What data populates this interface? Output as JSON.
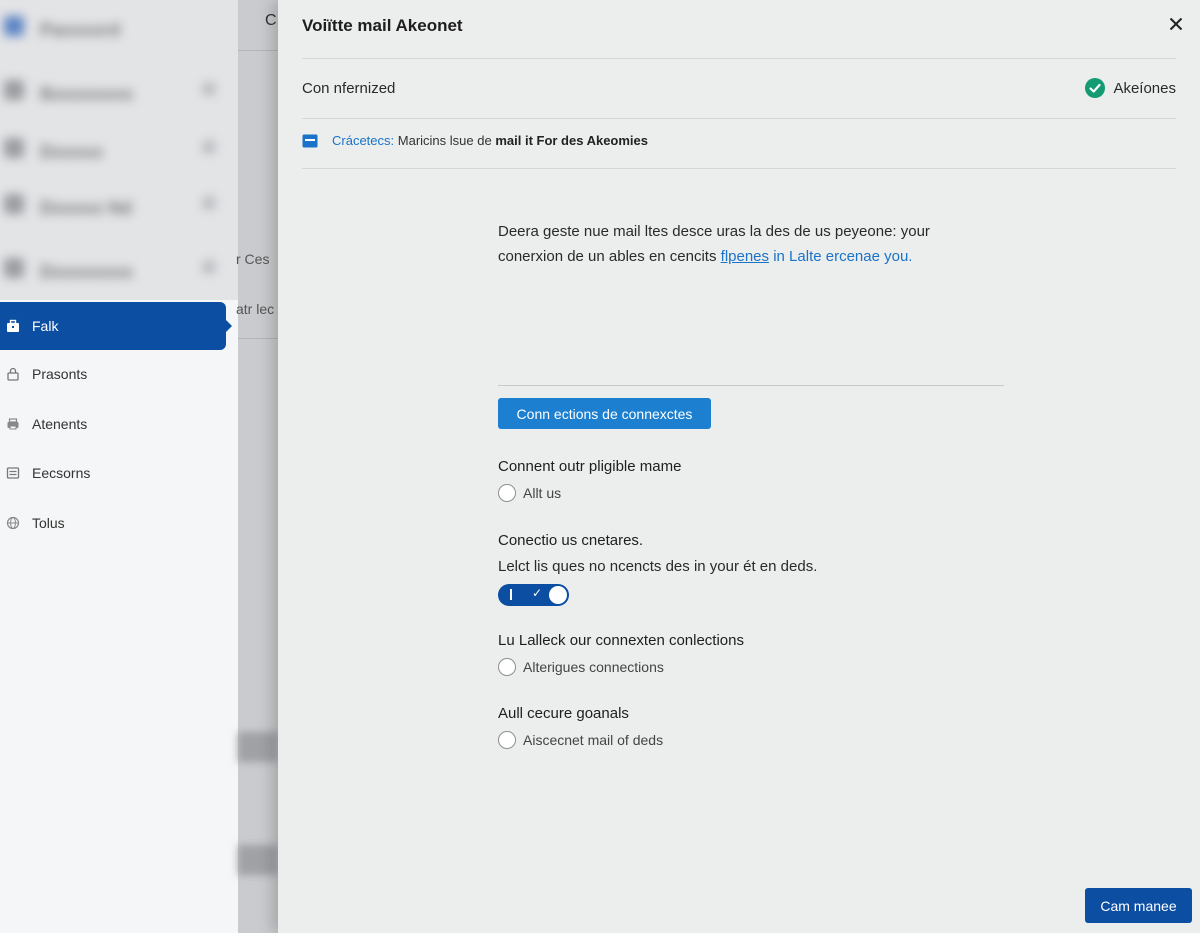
{
  "sidebar": {
    "blurred_items": [
      {
        "label": "Paxxxxrd"
      },
      {
        "label": "Bxxxxxxxx"
      },
      {
        "label": "Dxxxxx"
      },
      {
        "label": "Dxxxxx Nd"
      },
      {
        "label": "Dxxxxxxxx"
      }
    ],
    "items": [
      {
        "label": "Falk",
        "icon": "briefcase-icon",
        "active": true
      },
      {
        "label": "Prasonts",
        "icon": "lock-icon",
        "active": false
      },
      {
        "label": "Atenents",
        "icon": "printer-icon",
        "active": false
      },
      {
        "label": "Eecsorns",
        "icon": "list-icon",
        "active": false
      },
      {
        "label": "Tolus",
        "icon": "globe-icon",
        "active": false
      }
    ]
  },
  "background_pane": {
    "header_fragment": "C",
    "row1_fragment": "r Ces",
    "row2_fragment": "atr lec"
  },
  "dialog": {
    "title": "Voiïtte mail Akeonet",
    "status_label": "Con nfernized",
    "status_value": "Akeíones",
    "info": {
      "link_text": "Crácetecs:",
      "text": "Maricins lsue de",
      "bold_text": "mail it For des Akeomies"
    },
    "description": {
      "line1": "Deera geste nue mail ltes desce uras la des de us peyeone: your",
      "line2_start": "conerxion de un ables en cencits",
      "line2_link": "flpenes",
      "line2_end": "in Lalte ercenae you."
    },
    "primary_button": "Conn ections de connexctes",
    "fields": [
      {
        "label": "Connent outr pligible mame",
        "option": "Allt us"
      },
      {
        "label": "Conectio us cnetares.",
        "sub": "Lelct lis ques no ncencts des in your ét en deds."
      },
      {
        "label": "Lu Lalleck our connexten conlections",
        "option": "Alterigues connections"
      },
      {
        "label": "Aull cecure goanals",
        "option": "Aiscecnet mail of deds"
      }
    ],
    "footer_button": "Cam manee"
  },
  "colors": {
    "accent": "#0b4ea2",
    "button_blue": "#1c7fd0",
    "success": "#139b74",
    "link": "#1a73c8"
  }
}
